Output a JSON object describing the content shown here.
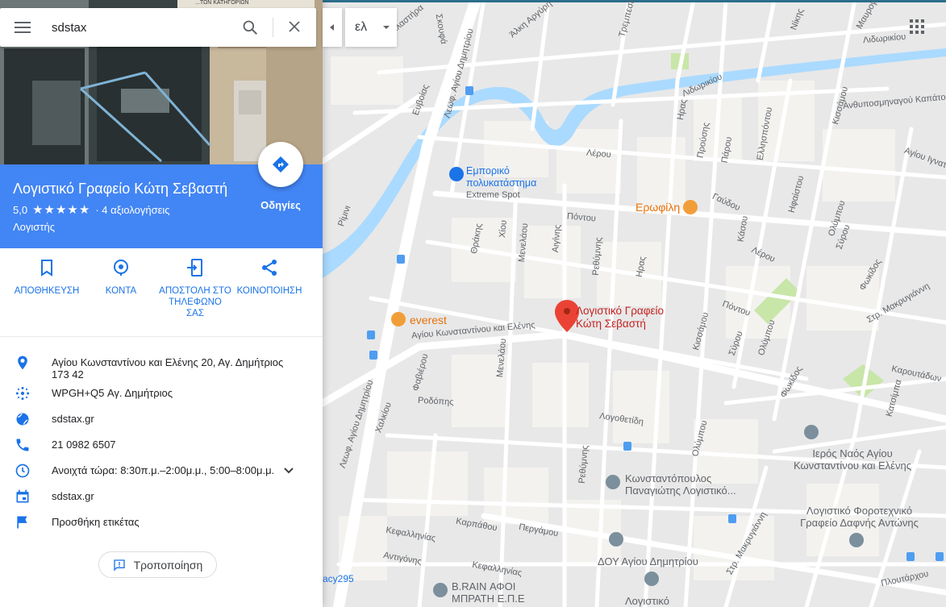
{
  "search": {
    "value": "sdstax",
    "placeholder": ""
  },
  "photo_sign_text": "...ΤΩΝ ΚΑΤΗΓΟΡΙΩΝ",
  "place": {
    "name": "Λογιστικό Γραφείο Κώτη Σεβαστή",
    "rating": "5,0",
    "stars": "★★★★★",
    "reviews": "· 4 αξιολογήσεις",
    "category": "Λογιστής",
    "directions_label": "Οδηγίες"
  },
  "actions": [
    {
      "label": "ΑΠΟΘΗΚΕΥΣΗ",
      "icon": "bookmark-icon"
    },
    {
      "label": "ΚΟΝΤΑ",
      "icon": "nearby-icon"
    },
    {
      "label": "ΑΠΟΣΤΟΛΗ ΣΤΟ ΤΗΛΕΦΩΝΟ ΣΑΣ",
      "icon": "send-to-phone-icon"
    },
    {
      "label": "ΚΟΙΝΟΠΟΙΗΣΗ",
      "icon": "share-icon"
    }
  ],
  "info": {
    "address_line1": "Αγίου Κωνσταντίνου και Ελένης 20, Αγ. Δημήτριος",
    "address_line2": "173 42",
    "plus_code": "WPGH+Q5 Αγ. Δημήτριος",
    "website": "sdstax.gr",
    "phone": "21 0982 6507",
    "hours": "Ανοιχτά τώρα:  8:30π.μ.–2:00μ.μ., 5:00–8:00μ.μ.",
    "menu_link": "sdstax.gr",
    "add_label": "Προσθήκη ετικέτας"
  },
  "edit_label": "Τροποποίηση",
  "language": "ελ",
  "map": {
    "marker_label_line1": "Λογιστικό Γραφείο",
    "marker_label_line2": "Κώτη Σεβαστή",
    "pois": {
      "mall_line1": "Εμπορικό",
      "mall_line2": "πολυκατάστημα",
      "mall_line3": "Extreme Spot",
      "erofili": "Ερωφίλη",
      "everest": "everest",
      "church_line1": "Ιερός Ναός Αγίου",
      "church_line2": "Κωνσταντίνου και Ελένης",
      "konst_line1": "Κωνσταντόπουλος",
      "konst_line2": "Παναγιώτης Λογιστικό...",
      "dafni_line1": "Λογιστικό Φοροτεχνικό",
      "dafni_line2": "Γραφείο Δαφνής Αντώνης",
      "doy": "ΔΟΥ Αγίου Δημητρίου",
      "brain_line1": "B.RAIN ΑΦΟΙ",
      "brain_line2": "ΜΠΡΑΤΗ Ε.Π.Ε",
      "logistiko": "Λογιστικό",
      "acy": "acy295"
    },
    "streets": {
      "leof_agiou_dimitriou_top": "Λεωφ. Αγίου Δημητρίου",
      "leof_agiou_dimitriou_bottom": "Λεωφ. Αγίου Δημητρίου",
      "agiou_konst": "Αγίου Κωνσταντίνου και Ελένης",
      "pontou": "Πόντου",
      "pontou2": "Πόντου",
      "lerou": "Λέρου",
      "lerou2": "Λέρου",
      "rimini": "Ρίμινι",
      "rodopis": "Ροδόπης",
      "kefallinias": "Κεφαλληνίας",
      "kefallinias2": "Κεφαλληνίας",
      "antygonis": "Αντιγόνης",
      "karpathou": "Καρπάθου",
      "pergamou": "Περγάμου",
      "karoutadon": "Καρουτάδων",
      "katsimpa": "Κατσίμπα",
      "logovetidi": "Λογοθετίδη",
      "olympou": "Ολύμπου",
      "olympou2": "Ολύμπου",
      "olympou3": "Ολύμπου",
      "fokidos": "Φωκίδος",
      "fokidos2": "Φωκίδος",
      "kissamou": "Κισσάμου",
      "kissamou2": "Κισσάμου",
      "rethymnis": "Ρεθύμνης",
      "rethymnis2": "Ρεθύμνης",
      "irodou": "Ηρας",
      "irodou2": "Ηρας",
      "aiginis": "Αιγίνης",
      "menelaou": "Μενελάου",
      "menelaou2": "Μενελάου",
      "thrakis": "Θράκης",
      "chiou": "Χίου",
      "fabierou": "Φαβιέρου",
      "chaleou": "Χαλκίου",
      "makrigianni": "Στρ. Μακρυγιάννη",
      "makrigianni2": "Στρ. Μακρυγιάννη",
      "sirou": "Σύρου",
      "sirou2": "Σύρου",
      "lidorikiou": "Λιδωρικίου",
      "lidorikiou2": "Λιδωρικίου",
      "ellispontou": "Ελλησπόντου",
      "gavdou": "Γαύδου",
      "iraistou": "Ηφαίστου",
      "anthypospoug": "Ανθυποσμηναγού Καπάτου",
      "agiou_ignatiou": "Αγίου Ιγνατ",
      "ploutarchou": "Πλουτάρχου",
      "kasoy": "Κάσου",
      "parou": "Πάρου",
      "prousis": "Προύσης",
      "mavroyeni": "Μαυρογ",
      "skoyfa": "Σκουφά",
      "plastira": "Πλαστήρα",
      "alki_argyri": "Άλκη Αργύρη",
      "evvias": "Ευβοίας",
      "tripolis": "Τρεμπεσίν",
      "nikis": "Νίκης"
    }
  }
}
